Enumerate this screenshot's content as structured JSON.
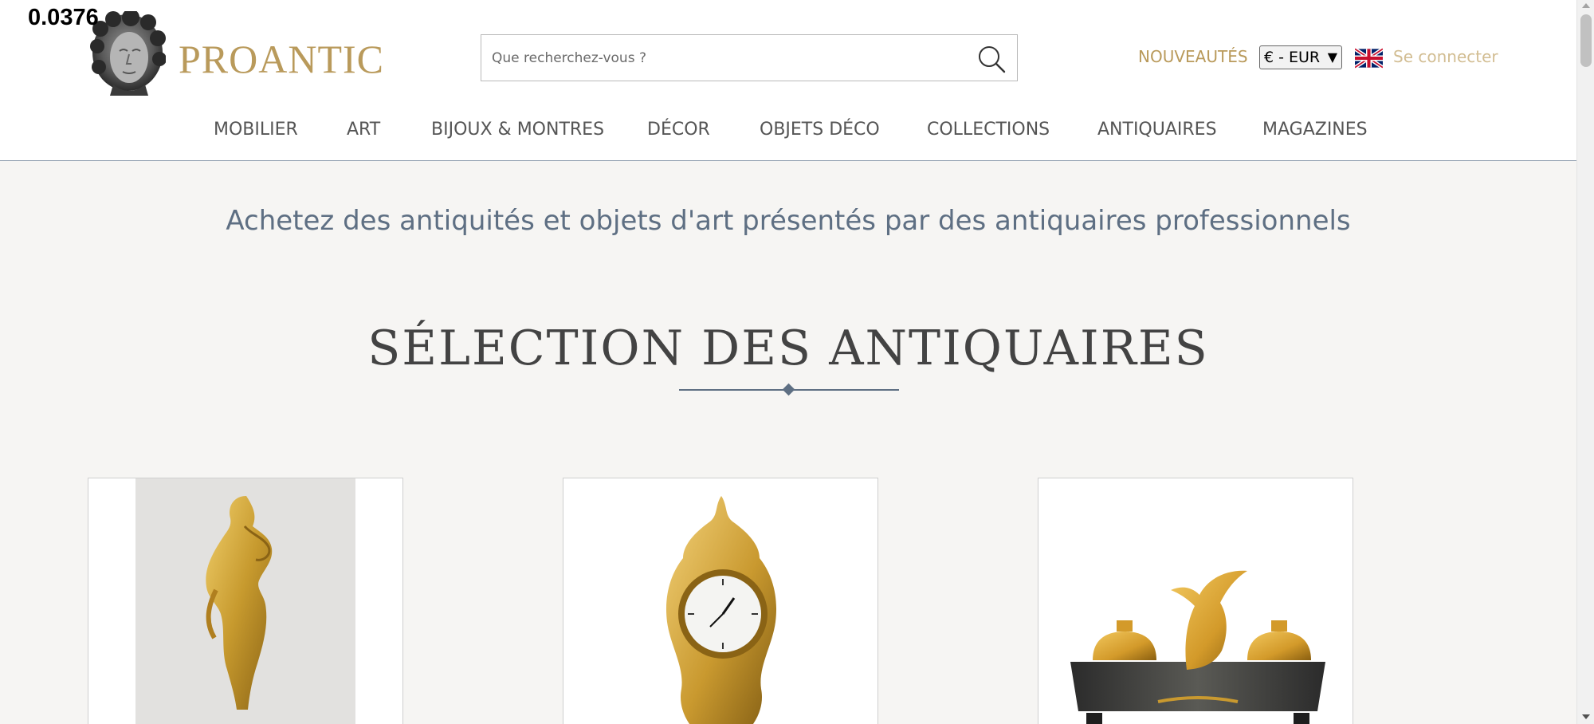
{
  "overlay": {
    "value": "0.0376"
  },
  "brand": {
    "name": "PROANTIC",
    "logo_icon": "classical-head-logo"
  },
  "search": {
    "placeholder": "Que recherchez-vous ?",
    "icon": "search-icon"
  },
  "header": {
    "new_label": "NOUVEAUTÉS",
    "currency_value": "€ - EUR",
    "language_flag": "uk-flag-icon",
    "login_label": "Se connecter"
  },
  "nav": {
    "items": [
      "MOBILIER",
      "ART",
      "BIJOUX & MONTRES",
      "DÉCOR",
      "OBJETS DÉCO",
      "COLLECTIONS",
      "ANTIQUAIRES",
      "MAGAZINES"
    ]
  },
  "main": {
    "tagline": "Achetez des antiquités et objets d'art présentés par des antiquaires professionnels",
    "section_title": "SÉLECTION DES ANTIQUAIRES"
  },
  "colors": {
    "brand_gold": "#b99a5b",
    "login_gold": "#d2bd92",
    "slate": "#5e6f83",
    "page_bg": "#f6f5f3"
  }
}
